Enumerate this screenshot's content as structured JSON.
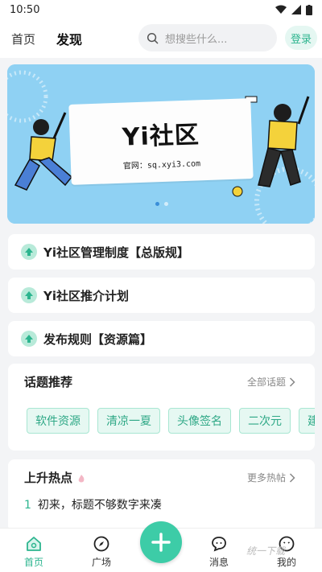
{
  "status_bar": {
    "time": "10:50"
  },
  "header": {
    "tabs": [
      {
        "label": "首页"
      },
      {
        "label": "发现"
      }
    ],
    "search_placeholder": "想搜些什么...",
    "login_label": "登录"
  },
  "banner": {
    "title": "Yi社区",
    "subtitle": "官网：sq.xyi3.com"
  },
  "notices": [
    {
      "text": "Yi社区管理制度【总版规】"
    },
    {
      "text": "Yi社区推介计划"
    },
    {
      "text": "发布规则【资源篇】"
    }
  ],
  "topics": {
    "title": "话题推荐",
    "more": "全部话题",
    "chips": [
      "软件资源",
      "清凉一夏",
      "头像签名",
      "二次元",
      "建站"
    ]
  },
  "hot": {
    "title": "上升热点",
    "more": "更多热帖",
    "items": [
      {
        "rank": "1",
        "text": "初来，标题不够数字来凑"
      }
    ]
  },
  "bottom_nav": {
    "items": [
      {
        "label": "首页"
      },
      {
        "label": "广场"
      },
      {
        "label": "消息"
      },
      {
        "label": "我的"
      }
    ]
  },
  "watermark": "统一下载",
  "colors": {
    "accent": "#3dcca7",
    "accent_text": "#2db58f",
    "banner_bg": "#8fd1f3"
  }
}
